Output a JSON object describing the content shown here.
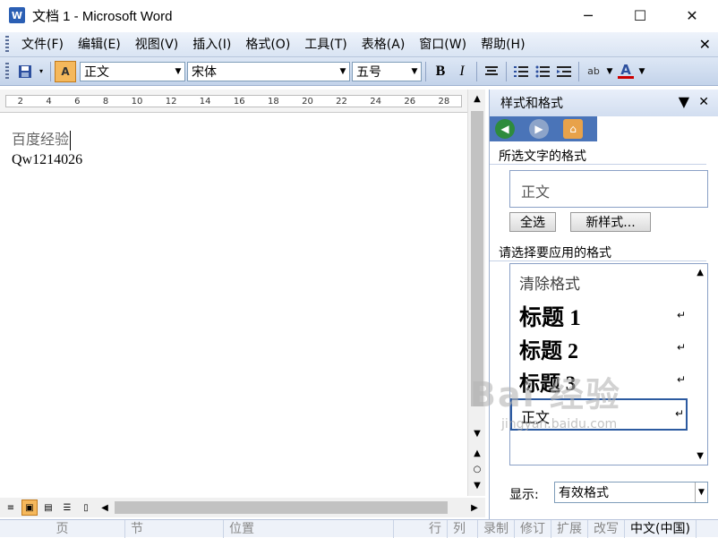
{
  "window": {
    "title": "文档 1 - Microsoft Word",
    "minimize": "─",
    "maximize": "☐",
    "close": "✕"
  },
  "menu": {
    "items": [
      "文件(F)",
      "编辑(E)",
      "视图(V)",
      "插入(I)",
      "格式(O)",
      "工具(T)",
      "表格(A)",
      "窗口(W)",
      "帮助(H)"
    ],
    "close": "✕"
  },
  "toolbar": {
    "style_value": "正文",
    "font_value": "宋体",
    "size_value": "五号",
    "bold": "B",
    "italic": "I",
    "underline_color": "#cc0000",
    "font_color_label": "A"
  },
  "ruler": {
    "ticks": [
      "2",
      "4",
      "6",
      "8",
      "10",
      "12",
      "14",
      "16",
      "18",
      "20",
      "22",
      "24",
      "26",
      "28"
    ]
  },
  "document": {
    "lines": [
      "百度经验",
      "Qw1214026"
    ]
  },
  "pane": {
    "title": "样式和格式",
    "selected_label": "所选文字的格式",
    "selected_value": "正文",
    "select_all_btn": "全选",
    "new_style_btn": "新样式...",
    "apply_label": "请选择要应用的格式",
    "styles": [
      "清除格式",
      "标题 1",
      "标题 2",
      "标题 3",
      "正文"
    ],
    "show_label": "显示:",
    "show_value": "有效格式"
  },
  "status": {
    "page": "页",
    "section": "节",
    "position": "位置",
    "line": "行",
    "column": "列",
    "rec": "录制",
    "trk": "修订",
    "ext": "扩展",
    "ovr": "改写",
    "lang": "中文(中国)"
  },
  "watermark": {
    "main": "Bai 经验",
    "sub": "jingyan.baidu.com"
  }
}
